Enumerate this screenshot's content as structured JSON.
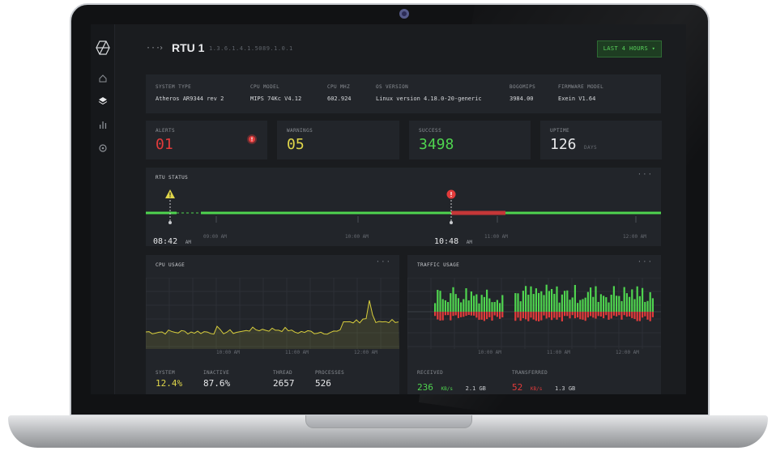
{
  "header": {
    "ellipsis": "···",
    "chevron": "›",
    "title": "RTU 1",
    "oid": "1.3.6.1.4.1.5089.1.0.1",
    "range_button": "LAST 4 HOURS ▾"
  },
  "system": [
    {
      "label": "SYSTEM TYPE",
      "value": "Atheros AR9344 rev 2"
    },
    {
      "label": "CPU MODEL",
      "value": "MIPS 74Kc V4.12"
    },
    {
      "label": "CPU MHZ",
      "value": "602.924"
    },
    {
      "label": "OS VERSION",
      "value": "Linux version 4.18.0-20-generic"
    },
    {
      "label": "BOGOMIPS",
      "value": "3984.00"
    },
    {
      "label": "FIRMWARE MODEL",
      "value": "Exein V1.64"
    }
  ],
  "stats": {
    "alerts": {
      "label": "ALERTS",
      "value": "01"
    },
    "warnings": {
      "label": "WARNINGS",
      "value": "05"
    },
    "success": {
      "label": "SUCCESS",
      "value": "3498"
    },
    "uptime": {
      "label": "UPTIME",
      "value": "126",
      "unit": "DAYS"
    }
  },
  "rtu_status": {
    "title": "RTU STATUS",
    "more": "···",
    "markers": [
      {
        "time": "08:42",
        "ampm": "AM",
        "type": "warning"
      },
      {
        "time": "10:48",
        "ampm": "AM",
        "type": "alert"
      }
    ],
    "ticks": [
      "09:00 AM",
      "10:00 AM",
      "11:00 AM",
      "12:00 AM"
    ]
  },
  "cpu_usage": {
    "title": "CPU USAGE",
    "more": "···",
    "ticks": [
      "10:00 AM",
      "11:00 AM",
      "12:00 AM"
    ],
    "stats": [
      {
        "label": "SYSTEM",
        "value": "12.4%"
      },
      {
        "label": "INACTIVE",
        "value": "87.6%"
      },
      {
        "label": "THREAD",
        "value": "2657"
      },
      {
        "label": "PROCESSES",
        "value": "526"
      }
    ]
  },
  "traffic_usage": {
    "title": "TRAFFIC USAGE",
    "more": "···",
    "ticks": [
      "10:00 AM",
      "11:00 AM",
      "12:00 AM"
    ],
    "received": {
      "label": "RECEIVED",
      "rate": "236",
      "rate_unit": "KB/s",
      "total": "2.1 GB"
    },
    "transferred": {
      "label": "TRANSFERRED",
      "rate": "52",
      "rate_unit": "KB/s",
      "total": "1.3 GB"
    }
  },
  "icons": [
    "exein-logo-icon",
    "home-icon",
    "layers-icon",
    "bar-chart-icon",
    "settings-icon"
  ],
  "colors": {
    "green": "#4fd44f",
    "red": "#e23b3b",
    "yellow": "#e0d64a",
    "background": "#1a1c1f",
    "card": "#22252a"
  }
}
